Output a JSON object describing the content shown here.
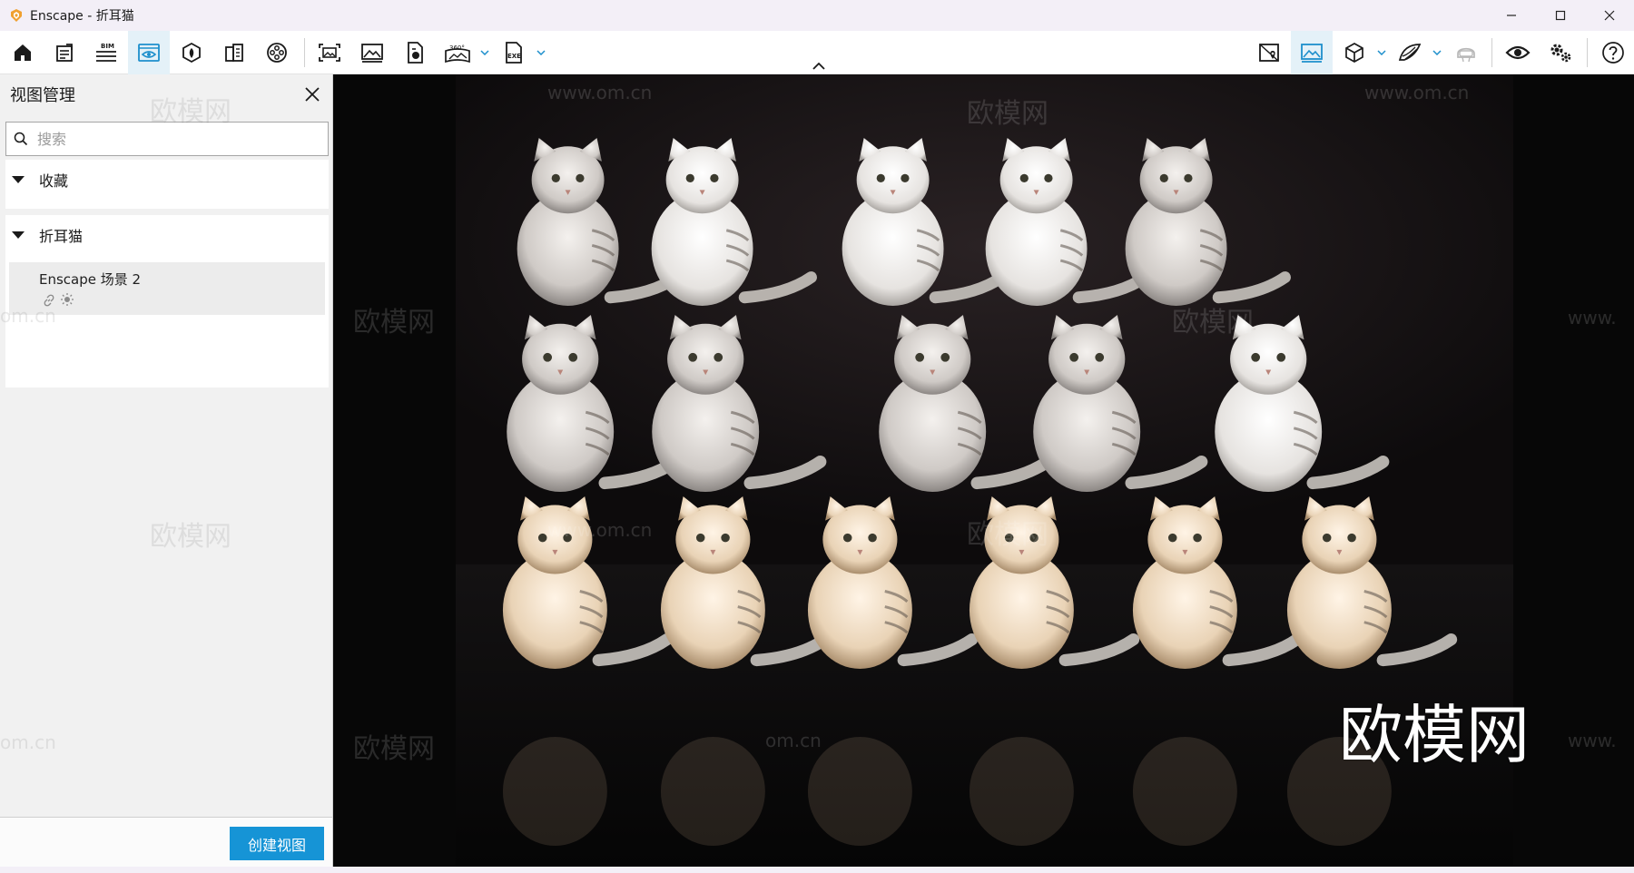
{
  "window": {
    "title": "Enscape - 折耳猫",
    "controls": [
      "minimize-icon",
      "maximize-icon",
      "close-icon"
    ]
  },
  "toolbar": {
    "left_icons": [
      "home-icon",
      "project-info-icon",
      "bim-icon",
      "view-management-icon",
      "asset-library-icon",
      "material-icon",
      "video-editor-icon",
      "screenshot-icon",
      "render-image-icon",
      "batch-render-icon",
      "panorama-icon",
      "export-exe-icon"
    ],
    "bim_label": "BIM",
    "panorama_label": "360°",
    "export_label": "EXE",
    "right_icons": [
      "map-icon",
      "visual-settings-icon",
      "view-mode-icon",
      "vr-icon",
      "headset-icon",
      "preview-eye-icon",
      "settings-icon",
      "help-icon"
    ]
  },
  "panel": {
    "title": "视图管理",
    "search_placeholder": "搜索",
    "sections": [
      {
        "label": "收藏",
        "expanded": true,
        "items": []
      },
      {
        "label": "折耳猫",
        "expanded": true,
        "items": [
          {
            "name": "Enscape 场景 2"
          }
        ]
      }
    ],
    "create_button": "创建视图"
  },
  "viewport": {
    "watermark_brand": "欧模网",
    "watermark_url": "www.om.cn",
    "watermark_url_partial": "om.cn",
    "watermark_url_cut": "www.",
    "big_watermark": "欧模网"
  },
  "colors": {
    "accent": "#1694d6",
    "active_tool_bg": "#e4f1f8",
    "viewport_bg": "#070707"
  }
}
